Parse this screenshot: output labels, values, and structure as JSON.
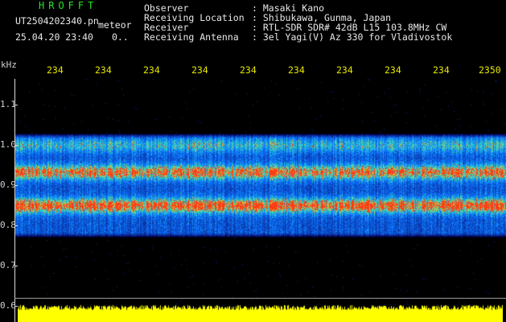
{
  "header": {
    "brand": "HROFFT",
    "filename": "UT2504202340.pn",
    "meteor_label": "meteor",
    "datetime": "25.04.20 23:40",
    "counter": "0..",
    "fields": [
      {
        "label": "Observer",
        "value": ": Masaki Kano"
      },
      {
        "label": "Receiving Location",
        "value": ": Shibukawa, Gunma, Japan"
      },
      {
        "label": "Receiver",
        "value": ": RTL-SDR SDR# 42dB L15 103.8MHz CW"
      },
      {
        "label": "Receiving Antenna",
        "value": ": 3el Yagi(V) Az 330 for Vladivostok"
      }
    ]
  },
  "axes": {
    "y_unit": "kHz",
    "y_ticks": [
      "1.1",
      "1.0",
      "0.9",
      "0.8",
      "0.7",
      "0.6"
    ],
    "x_ticks": [
      "234",
      "234",
      "234",
      "234",
      "234",
      "234",
      "234",
      "234",
      "234",
      "2350"
    ]
  },
  "spectrogram": {
    "bands_khz": [
      {
        "center": 1.0,
        "intensity": 0.45
      },
      {
        "center": 0.933,
        "intensity": 0.9
      },
      {
        "center": 0.85,
        "intensity": 1.0
      }
    ],
    "colors": {
      "background": "#000000",
      "low": "#0a1a8c",
      "mid": "#1e5aff",
      "high": "#2fd0c0",
      "peak": "#ff3a1a",
      "level": "#ffff00"
    }
  }
}
